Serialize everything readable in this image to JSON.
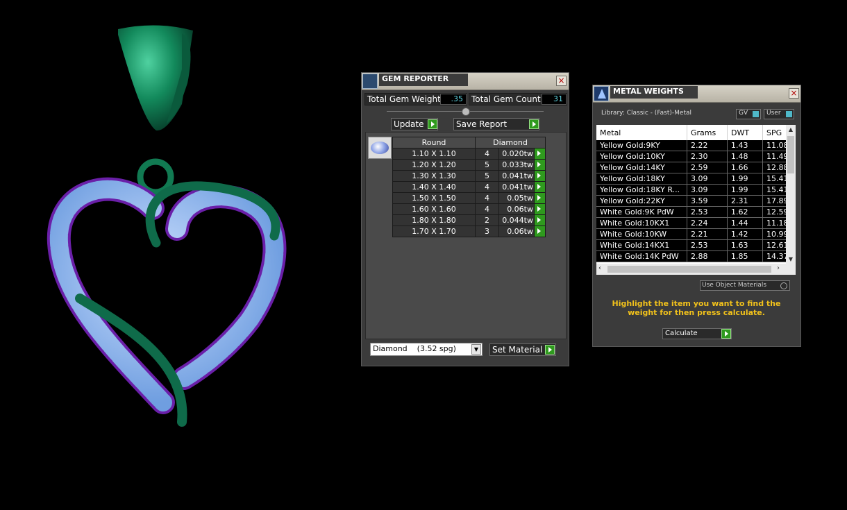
{
  "gem_reporter": {
    "title": "GEM REPORTER",
    "close": "×",
    "total_weight_label": "Total Gem Weight",
    "total_weight_value": ".35",
    "total_count_label": "Total Gem Count",
    "total_count_value": "31",
    "update_label": "Update",
    "save_report_label": "Save Report",
    "shape_header": "Round",
    "material_header": "Diamond",
    "rows": [
      {
        "size": "1.10 X 1.10",
        "count": "4",
        "weight": "0.020tw"
      },
      {
        "size": "1.20 X 1.20",
        "count": "5",
        "weight": "0.033tw"
      },
      {
        "size": "1.30 X 1.30",
        "count": "5",
        "weight": "0.041tw"
      },
      {
        "size": "1.40 X 1.40",
        "count": "4",
        "weight": "0.041tw"
      },
      {
        "size": "1.50 X 1.50",
        "count": "4",
        "weight": "0.05tw"
      },
      {
        "size": "1.60 X 1.60",
        "count": "4",
        "weight": "0.06tw"
      },
      {
        "size": "1.80 X 1.80",
        "count": "2",
        "weight": "0.044tw"
      },
      {
        "size": "1.70 X 1.70",
        "count": "3",
        "weight": "0.06tw"
      }
    ],
    "material_select": "Diamond    (3.52 spg)",
    "set_material_label": "Set Material"
  },
  "metal_weights": {
    "title": "METAL WEIGHTS",
    "close": "×",
    "library": "Library: Classic - (Fast)-Metal",
    "gv_label": "GV",
    "user_label": "User",
    "columns": [
      "Metal",
      "Grams",
      "DWT",
      "SPG"
    ],
    "rows": [
      {
        "metal": "Yellow Gold:9KY",
        "grams": "2.22",
        "dwt": "1.43",
        "spg": "11.08"
      },
      {
        "metal": "Yellow Gold:10KY",
        "grams": "2.30",
        "dwt": "1.48",
        "spg": "11.49"
      },
      {
        "metal": "Yellow Gold:14KY",
        "grams": "2.59",
        "dwt": "1.66",
        "spg": "12.88"
      },
      {
        "metal": "Yellow Gold:18KY",
        "grams": "3.09",
        "dwt": "1.99",
        "spg": "15.41"
      },
      {
        "metal": "Yellow Gold:18KY R...",
        "grams": "3.09",
        "dwt": "1.99",
        "spg": "15.41"
      },
      {
        "metal": "Yellow Gold:22KY",
        "grams": "3.59",
        "dwt": "2.31",
        "spg": "17.89"
      },
      {
        "metal": "White Gold:9K PdW",
        "grams": "2.53",
        "dwt": "1.62",
        "spg": "12.59"
      },
      {
        "metal": "White Gold:10KX1",
        "grams": "2.24",
        "dwt": "1.44",
        "spg": "11.18"
      },
      {
        "metal": "White Gold:10KW",
        "grams": "2.21",
        "dwt": "1.42",
        "spg": "10.99"
      },
      {
        "metal": "White Gold:14KX1",
        "grams": "2.53",
        "dwt": "1.63",
        "spg": "12.61"
      },
      {
        "metal": "White Gold:14K PdW",
        "grams": "2.88",
        "dwt": "1.85",
        "spg": "14.37"
      }
    ],
    "use_object_materials": "Use Object Materials",
    "instruction": "Highlight the item you want to find the weight for then press calculate.",
    "calculate_label": "Calculate"
  },
  "colors": {
    "metal": "#0f6b4a",
    "gem": "#8fb7f0",
    "prong": "#6a1fa8",
    "accent_text": "#f2c21b"
  }
}
